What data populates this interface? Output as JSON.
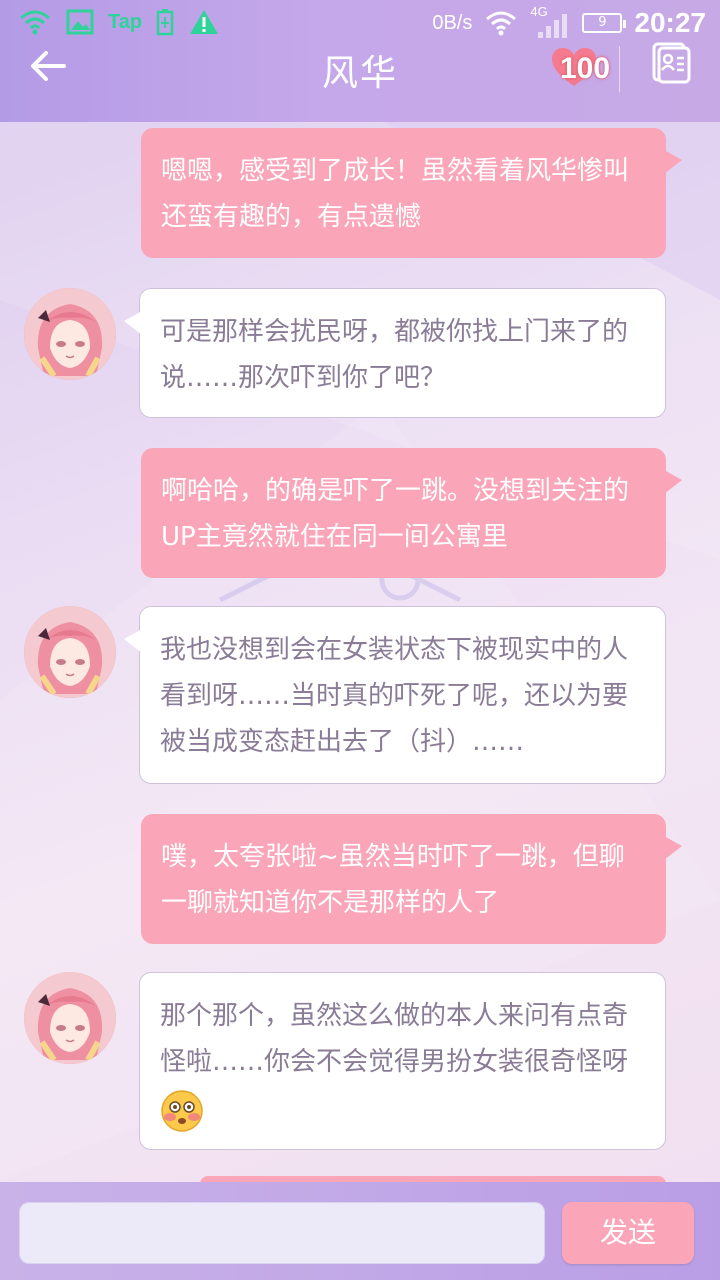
{
  "status_bar": {
    "tap_label": "Tap",
    "net_speed": "0B/s",
    "network_type": "4G",
    "battery": "9",
    "time": "20:27"
  },
  "header": {
    "title": "风华",
    "affection": "100"
  },
  "messages": [
    {
      "from": "me",
      "text": "嗯嗯，感受到了成长！虽然看着风华惨叫还蛮有趣的，有点遗憾"
    },
    {
      "from": "them",
      "text": "可是那样会扰民呀，都被你找上门来了的说……那次吓到你了吧？"
    },
    {
      "from": "me",
      "text": "啊哈哈，的确是吓了一跳。没想到关注的UP主竟然就住在同一间公寓里"
    },
    {
      "from": "them",
      "text": "我也没想到会在女装状态下被现实中的人看到呀……当时真的吓死了呢，还以为要被当成变态赶出去了（抖）……"
    },
    {
      "from": "me",
      "text": "噗，太夸张啦~虽然当时吓了一跳，但聊一聊就知道你不是那样的人了"
    },
    {
      "from": "them",
      "text": "那个那个，虽然这么做的本人来问有点奇怪啦……你会不会觉得男扮女装很奇怪呀",
      "emoji": "flushed-face-icon"
    }
  ],
  "input": {
    "value": "",
    "send_label": "发送"
  },
  "colors": {
    "header_bg": "#b49be6",
    "my_bubble": "#fba5b8",
    "their_bubble": "#ffffff",
    "their_text": "#8a7b96"
  }
}
